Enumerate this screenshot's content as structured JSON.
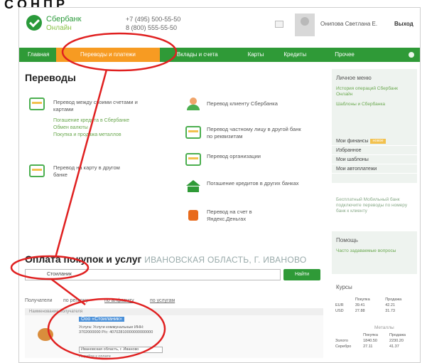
{
  "caption": "С О Н П Р",
  "header": {
    "logo_line1": "Сбербанк",
    "logo_line2": "Онлайн",
    "phone1": "+7 (495) 500-55-50",
    "phone2": "8 (800) 555-55-50",
    "username": "Онипова Светлана Е.",
    "logout": "Выход"
  },
  "nav": {
    "items": [
      "Главная",
      "Переводы и платежи",
      "Вклады и счета",
      "Карты",
      "Кредиты",
      "Прочее"
    ]
  },
  "transfers": {
    "title": "Переводы",
    "own_accounts": "Перевод между своими счетами и картами",
    "sublinks": [
      "Погашение кредита в Сбербанке",
      "Обмен валюты",
      "Покупка и продажа металлов"
    ],
    "card_other": "Перевод на карту в другом банке",
    "sber_client": "Перевод клиенту Сбербанка",
    "private_person": "Перевод частному лицу в другой банк по реквизитам",
    "organization": "Перевод организации",
    "loan_other": "Погашение кредитов в других банках",
    "yandex": "Перевод на счет в Яндекс.Деньгах"
  },
  "payments": {
    "title": "Оплата покупок и услуг",
    "region": "ИВАНОВСКАЯ ОБЛАСТЬ, Г. ИВАНОВО",
    "search_value": "Стоиланик",
    "search_button": "Найти",
    "filters": [
      "Получатели",
      "по региону",
      "по алфавиту",
      "по услугам"
    ],
    "result_head": "Наименование получателя",
    "result_title": "Ооо «Стоиланик»",
    "result_meta": "Услуга: Услуги коммунальные ИНН: 3702000000 Р/с: 40702810000000000000",
    "result_select": "Ивановская область, г. Иваново",
    "result_foot": "Перейти к оплате"
  },
  "sidebar": {
    "menu_title": "Личное меню",
    "menu_links": [
      "История операций Сбербанк Онлайн",
      "Шаблоны и Сбербанка"
    ],
    "items": [
      "Мои финансы",
      "Избранное",
      "Мои шаблоны",
      "Мои автоплатежи"
    ],
    "finance_badge": "новое",
    "promo": "Бесплатный Мобильный банк подключите переводы по номеру банк к клиенту",
    "help_title": "Помощь",
    "help_link": "Часто задаваемые вопросы",
    "rates_title": "Курсы",
    "rates_head": [
      "Покупка",
      "Продажа"
    ],
    "rates": [
      [
        "EUR",
        "39.41",
        "42.21"
      ],
      [
        "USD",
        "27.88",
        "31.73"
      ]
    ],
    "rates_link": "Металлы",
    "rates_head2": [
      "Покупка",
      "Продажа"
    ],
    "metals": [
      [
        "Золото",
        "1840.50",
        "2230.20"
      ],
      [
        "Серебро",
        "27.11",
        "41.37"
      ]
    ]
  }
}
